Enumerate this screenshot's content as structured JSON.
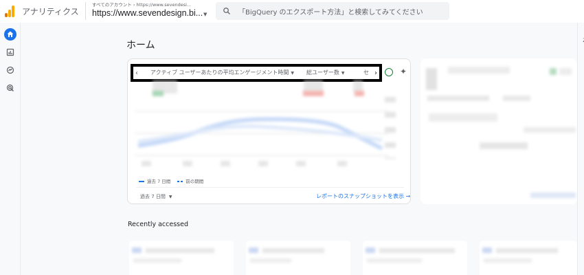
{
  "header": {
    "app_name": "アナリティクス",
    "account_crumb": "すべてのアカウント › https://www.sevendesi...",
    "property_name": "https://www.sevendesign.bi...",
    "search_placeholder": "「BigQuery のエクスポート方法」と検索してみてください"
  },
  "brand_colors": {
    "logo_orange": "#f9ab00",
    "logo_dark_orange": "#e37400",
    "accent": "#1a73e8"
  },
  "nav": {
    "items": [
      {
        "icon": "home-icon",
        "active": true
      },
      {
        "icon": "reports-icon",
        "active": false
      },
      {
        "icon": "explore-icon",
        "active": false
      },
      {
        "icon": "advertising-icon",
        "active": false
      }
    ]
  },
  "page": {
    "title": "ホーム"
  },
  "overview_card": {
    "tabs": [
      "アクティブ ユーザーあたりの平均エンゲージメント時間",
      "総ユーザー数",
      "セ"
    ],
    "legend_current": "過去 7 日間",
    "legend_previous": "前の期間",
    "period": "過去 7 日間",
    "snapshot_link": "レポートのスナップショットを表示 →"
  },
  "recent": {
    "title": "Recently accessed"
  }
}
